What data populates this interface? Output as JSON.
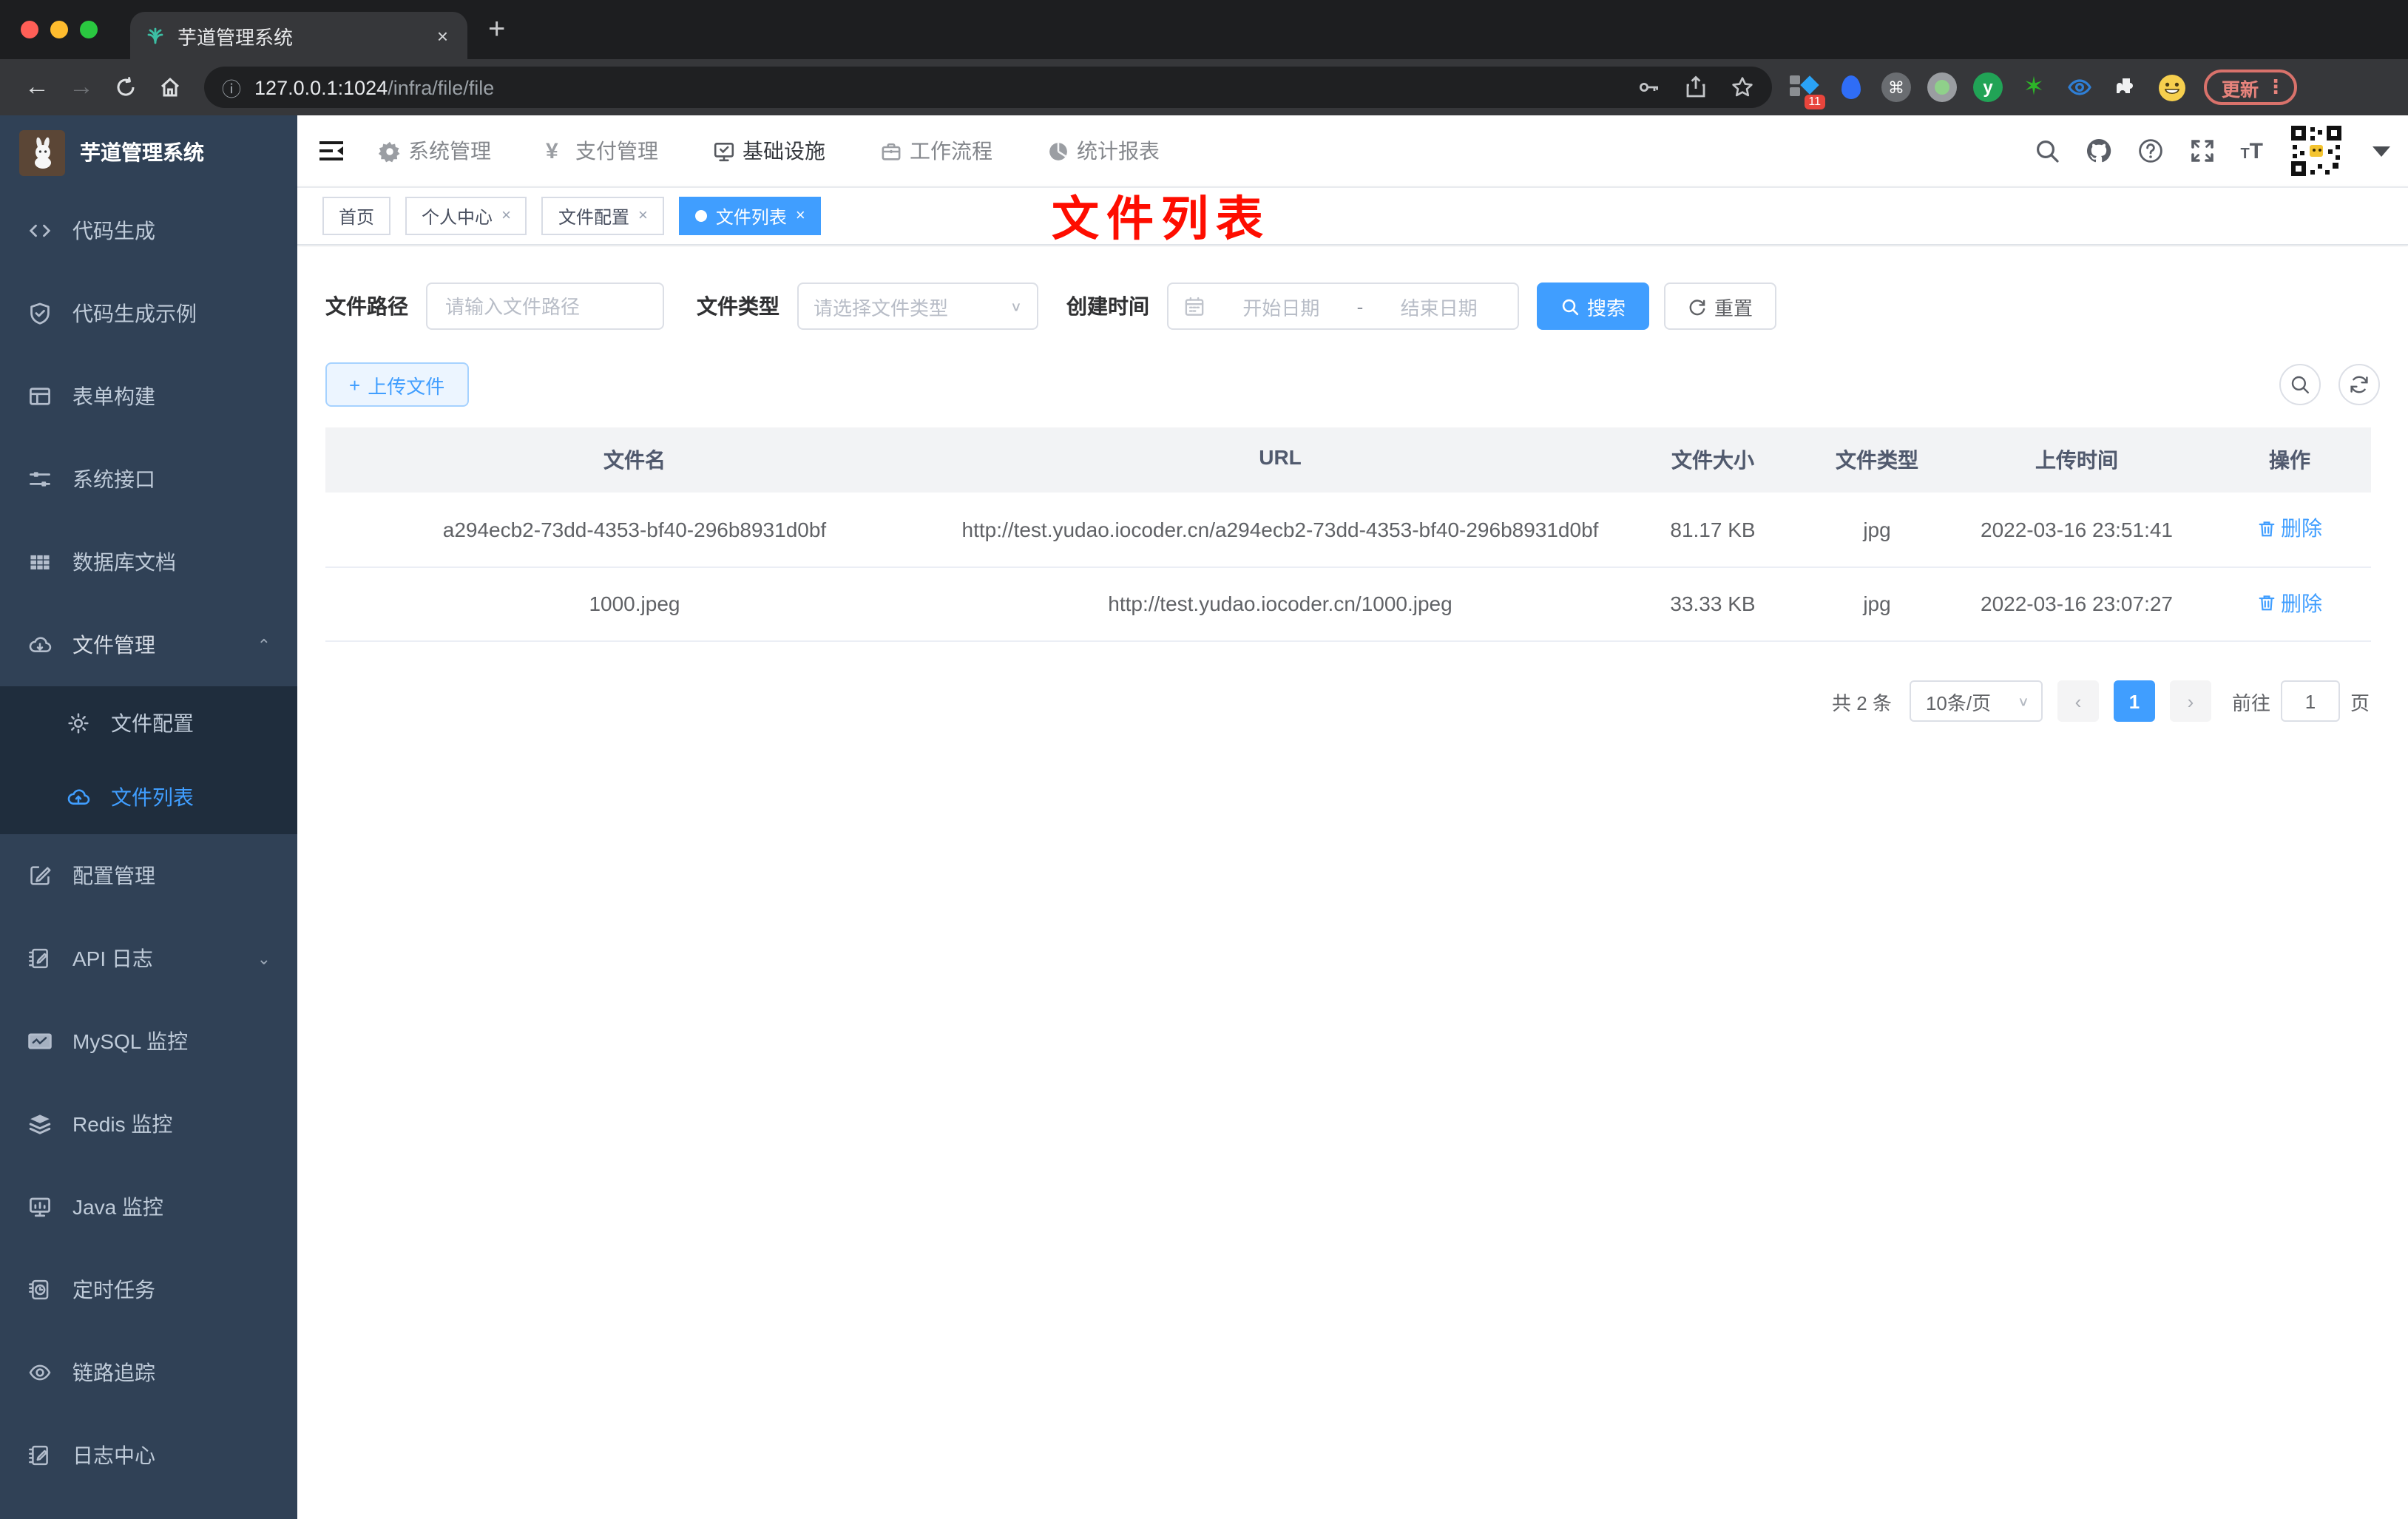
{
  "browser": {
    "tab_title": "芋道管理系统",
    "close_tab": "×",
    "new_tab": "+",
    "url_host": "127.0.0.1:1024",
    "url_path": "/infra/file/file",
    "ext_badge": "11",
    "cmd_glyph": "⌘",
    "y_glyph": "y",
    "star_glyph": "✶",
    "update_label": "更新",
    "menu_dots": "⋮"
  },
  "sidebar": {
    "title": "芋道管理系统",
    "items": [
      {
        "label": "代码生成"
      },
      {
        "label": "代码生成示例"
      },
      {
        "label": "表单构建"
      },
      {
        "label": "系统接口"
      },
      {
        "label": "数据库文档"
      },
      {
        "label": "文件管理"
      },
      {
        "label": "文件配置"
      },
      {
        "label": "文件列表"
      },
      {
        "label": "配置管理"
      },
      {
        "label": "API 日志"
      },
      {
        "label": "MySQL 监控"
      },
      {
        "label": "Redis 监控"
      },
      {
        "label": "Java 监控"
      },
      {
        "label": "定时任务"
      },
      {
        "label": "链路追踪"
      },
      {
        "label": "日志中心"
      }
    ]
  },
  "topnav": {
    "items": [
      {
        "label": "系统管理"
      },
      {
        "label": "支付管理"
      },
      {
        "label": "基础设施"
      },
      {
        "label": "工作流程"
      },
      {
        "label": "统计报表"
      }
    ]
  },
  "tabs": [
    {
      "label": "首页"
    },
    {
      "label": "个人中心",
      "close": "×"
    },
    {
      "label": "文件配置",
      "close": "×"
    },
    {
      "label": "文件列表",
      "close": "×"
    }
  ],
  "annotation": "文件列表",
  "filters": {
    "path_label": "文件路径",
    "path_placeholder": "请输入文件路径",
    "type_label": "文件类型",
    "type_placeholder": "请选择文件类型",
    "date_label": "创建时间",
    "date_start": "开始日期",
    "date_separator": "-",
    "date_end": "结束日期",
    "search_label": "搜索",
    "reset_label": "重置"
  },
  "actions": {
    "upload_label": "上传文件",
    "plus": "+"
  },
  "table": {
    "headers": [
      "文件名",
      "URL",
      "文件大小",
      "文件类型",
      "上传时间",
      "操作"
    ],
    "rows": [
      {
        "name": "a294ecb2-73dd-4353-bf40-296b8931d0bf",
        "url": "http://test.yudao.iocoder.cn/a294ecb2-73dd-4353-bf40-296b8931d0bf",
        "size": "81.17 KB",
        "type": "jpg",
        "time": "2022-03-16 23:51:41",
        "action": "删除"
      },
      {
        "name": "1000.jpeg",
        "url": "http://test.yudao.iocoder.cn/1000.jpeg",
        "size": "33.33 KB",
        "type": "jpg",
        "time": "2022-03-16 23:07:27",
        "action": "删除"
      }
    ]
  },
  "pagination": {
    "total": "共 2 条",
    "page_size": "10条/页",
    "prev": "‹",
    "page": "1",
    "next": "›",
    "goto_label": "前往",
    "goto_value": "1",
    "page_unit": "页"
  },
  "colors": {
    "accent": "#409eff",
    "sidebar_bg": "#304156",
    "sidebar_submenu_bg": "#1f2d3d",
    "annotation_red": "#fe0d00",
    "chrome_update_red": "#d9726b",
    "table_header_bg": "#f2f3f5"
  }
}
